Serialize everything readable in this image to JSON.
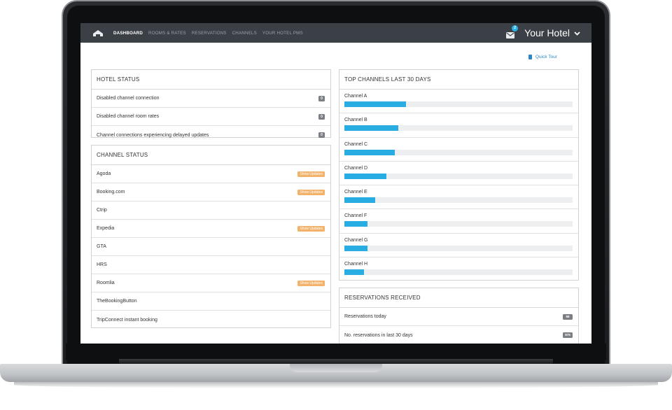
{
  "nav": {
    "items": [
      {
        "label": "DASHBOARD",
        "active": true
      },
      {
        "label": "ROOMS & RATES",
        "active": false
      },
      {
        "label": "RESERVATIONS",
        "active": false
      },
      {
        "label": "CHANNELS",
        "active": false
      },
      {
        "label": "YOUR HOTEL PMS",
        "active": false
      }
    ],
    "mail_count": "2",
    "hotel_name": "Your Hotel"
  },
  "quick_tour": {
    "label": "Quick Tour"
  },
  "hotel_status": {
    "title": "HOTEL STATUS",
    "rows": [
      {
        "label": "Disabled channel connection",
        "count": "0"
      },
      {
        "label": "Disabled channel room rates",
        "count": "0"
      },
      {
        "label": "Channel connections experiencing delayed updates",
        "count": "0"
      }
    ]
  },
  "channel_status": {
    "title": "CHANNEL STATUS",
    "badge_label": "Show Updates",
    "rows": [
      {
        "label": "Agoda",
        "has_updates": true
      },
      {
        "label": "Booking.com",
        "has_updates": true
      },
      {
        "label": "Ctrip",
        "has_updates": false
      },
      {
        "label": "Expedia",
        "has_updates": true
      },
      {
        "label": "GTA",
        "has_updates": false
      },
      {
        "label": "HRS",
        "has_updates": false
      },
      {
        "label": "Roomlia",
        "has_updates": true
      },
      {
        "label": "TheBookingButton",
        "has_updates": false
      },
      {
        "label": "TripConnect instant booking",
        "has_updates": false
      }
    ]
  },
  "top_channels": {
    "title": "TOP CHANNELS LAST 30 DAYS",
    "channels": [
      {
        "label": "Channel A",
        "share": 0.27
      },
      {
        "label": "Channel B",
        "share": 0.235
      },
      {
        "label": "Channel C",
        "share": 0.22
      },
      {
        "label": "Channel D",
        "share": 0.185
      },
      {
        "label": "Channel E",
        "share": 0.135
      },
      {
        "label": "Channel F",
        "share": 0.1
      },
      {
        "label": "Channel G",
        "share": 0.1
      },
      {
        "label": "Channel H",
        "share": 0.085
      }
    ]
  },
  "reservations": {
    "title": "RESERVATIONS RECEIVED",
    "rows": [
      {
        "label": "Reservations today",
        "count": "98"
      },
      {
        "label": "No. reservations in last 30 days",
        "count": "875"
      }
    ]
  },
  "colors": {
    "nav_bg": "#3b4046",
    "accent_blue": "#28ade3",
    "update_orange": "#f2b26a",
    "badge_gray": "#7b7f84"
  }
}
